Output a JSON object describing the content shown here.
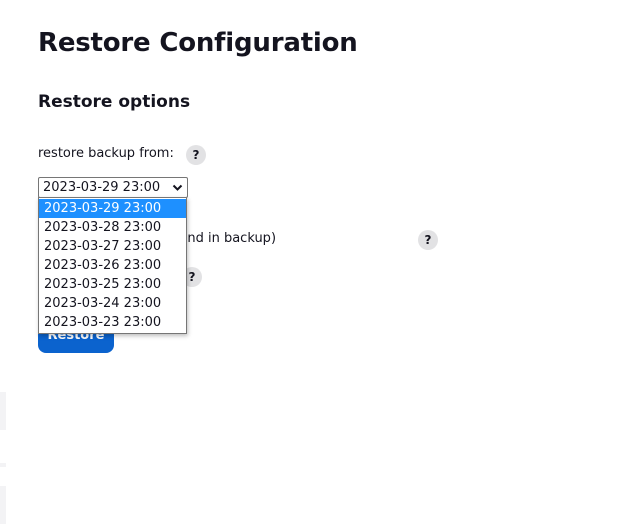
{
  "page": {
    "title": "Restore Configuration"
  },
  "restore_options": {
    "heading": "Restore options",
    "backup_label": "restore backup from:",
    "selected_backup": "2023-03-29 23:00",
    "backup_options": [
      "2023-03-29 23:00",
      "2023-03-28 23:00",
      "2023-03-27 23:00",
      "2023-03-26 23:00",
      "2023-03-25 23:00",
      "2023-03-24 23:00",
      "2023-03-23 23:00"
    ],
    "option1_text_visible": "d number file (if found in backup)",
    "help_glyph": "?",
    "chevron_glyph": "⌄"
  },
  "actions": {
    "restore_label": "Restore"
  },
  "colors": {
    "accent": "#0b63ce",
    "selected_option": "#1e90ff",
    "help_bg": "#e2e2e4"
  },
  "icons": {
    "help": "help-icon",
    "dropdown": "chevron-down-icon"
  }
}
